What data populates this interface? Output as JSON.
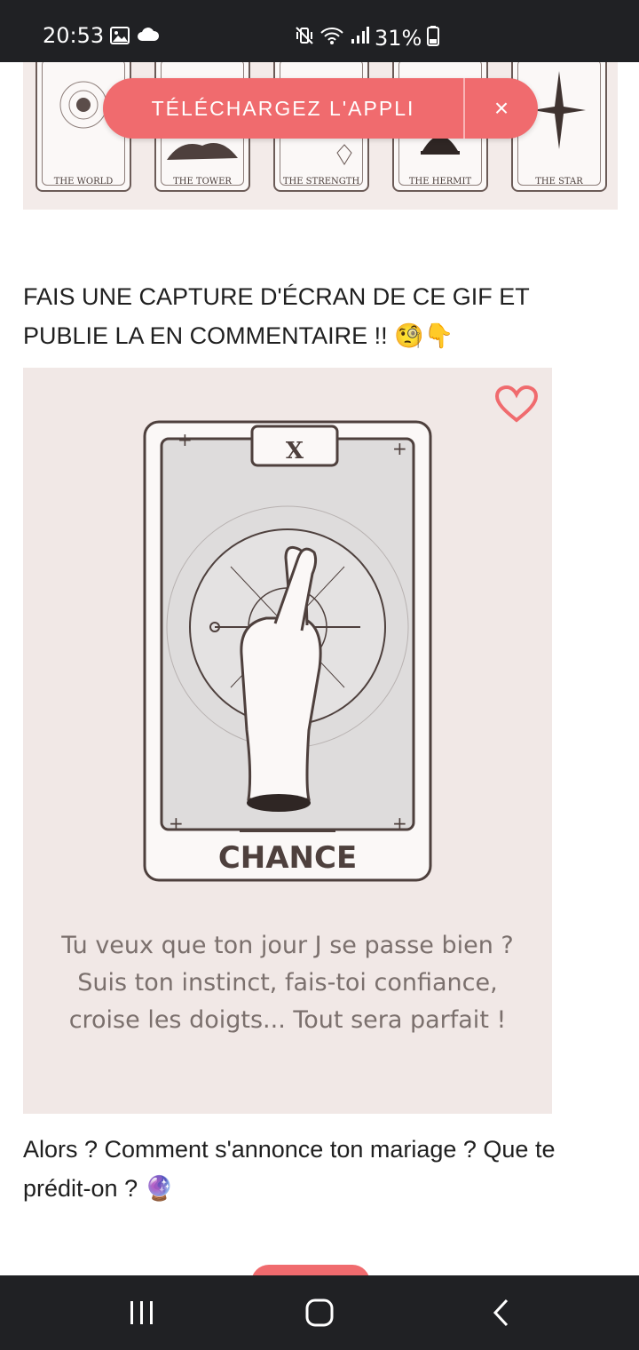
{
  "status_bar": {
    "time": "20:53",
    "battery_percent": "31%",
    "left_icons": [
      "gallery-icon",
      "cloud-icon"
    ],
    "right_icons": [
      "vibrate-mute-icon",
      "wifi-icon",
      "signal-icon",
      "battery-icon"
    ]
  },
  "banner": {
    "cards": [
      "THE WORLD",
      "THE TOWER",
      "THE STRENGTH",
      "THE HERMIT",
      "THE STAR"
    ],
    "download_label": "TÉLÉCHARGEZ L'APPLI",
    "close_symbol": "×"
  },
  "heading": "FAIS UNE CAPTURE D'ÉCRAN DE CE GIF ET PUBLIE LA EN COMMENTAIRE !! 🧐👇",
  "gif": {
    "roman_numeral": "X",
    "card_name": "CHANCE",
    "message": "Tu veux que ton jour J se passe bien ? Suis ton instinct, fais-toi confiance, croise les doigts... Tout sera parfait !",
    "accent_color": "#f06b6e"
  },
  "footer_text": "Alors ? Comment s'annonce ton mariage ? Que te prédit-on ? 🔮",
  "nav": {
    "buttons": [
      "recent-apps-icon",
      "home-icon",
      "back-icon"
    ]
  }
}
